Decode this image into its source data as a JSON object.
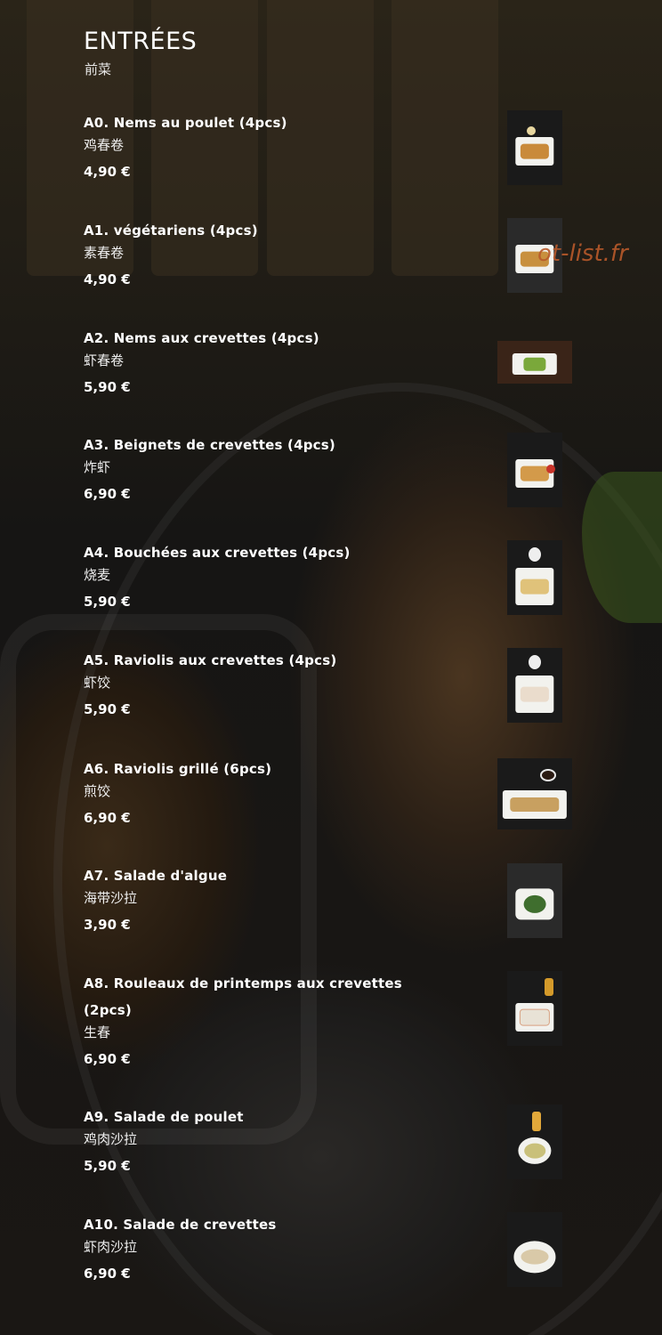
{
  "section": {
    "title": "ENTRÉES",
    "subtitle": "前菜"
  },
  "watermark": "ot-list.fr",
  "items": [
    {
      "name": "A0. Nems au poulet (4pcs)",
      "cn": "鸡春卷",
      "price": "4,90 €",
      "photo_icon": "spring-rolls-photo",
      "food_color": "#c98a3a"
    },
    {
      "name": "A1. végétariens (4pcs)",
      "cn": "素春卷",
      "price": "4,90 €",
      "photo_icon": "spring-rolls-photo",
      "food_color": "#c8903e"
    },
    {
      "name": "A2. Nems aux crevettes (4pcs)",
      "cn": "虾春卷",
      "price": "5,90 €",
      "photo_icon": "spring-rolls-photo",
      "food_color": "#7aa83a"
    },
    {
      "name": "A3. Beignets de crevettes (4pcs)",
      "cn": "炸虾",
      "price": "6,90 €",
      "photo_icon": "fried-shrimp-photo",
      "food_color": "#d39a4a"
    },
    {
      "name": "A4. Bouchées aux crevettes (4pcs)",
      "cn": "烧麦",
      "price": "5,90 €",
      "photo_icon": "dumplings-photo",
      "food_color": "#e0c27a"
    },
    {
      "name": "A5. Raviolis aux crevettes (4pcs)",
      "cn": "虾饺",
      "price": "5,90 €",
      "photo_icon": "dumplings-photo",
      "food_color": "#eadccc"
    },
    {
      "name": "A6. Raviolis grillé (6pcs)",
      "cn": "煎饺",
      "price": "6,90 €",
      "photo_icon": "grilled-dumplings-photo",
      "food_color": "#c8a060"
    },
    {
      "name": "A7. Salade d'algue",
      "cn": "海带沙拉",
      "price": "3,90 €",
      "photo_icon": "seaweed-salad-photo",
      "food_color": "#3f6e2e"
    },
    {
      "name": "A8. Rouleaux de printemps aux crevettes (2pcs)",
      "cn": "生春",
      "price": "6,90 €",
      "photo_icon": "spring-rolls-fresh-photo",
      "food_color": "#e8e2d6"
    },
    {
      "name": "A9. Salade de poulet",
      "cn": "鸡肉沙拉",
      "price": "5,90 €",
      "photo_icon": "chicken-salad-photo",
      "food_color": "#c9c07a"
    },
    {
      "name": "A10. Salade de crevettes",
      "cn": "虾肉沙拉",
      "price": "6,90 €",
      "photo_icon": "shrimp-salad-photo",
      "food_color": "#d9c9a8"
    }
  ]
}
